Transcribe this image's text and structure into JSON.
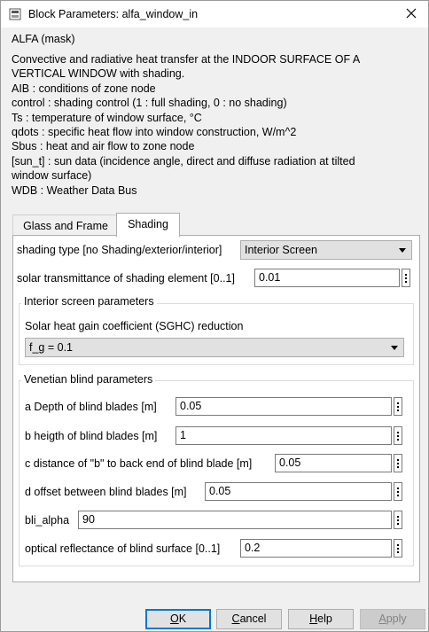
{
  "window": {
    "title": "Block Parameters: alfa_window_in",
    "mask_title": "ALFA (mask)"
  },
  "description": [
    "Convective and radiative heat transfer at the INDOOR SURFACE OF A",
    "VERTICAL WINDOW with shading.",
    "AIB  : conditions of zone node",
    "control : shading control (1 : full shading, 0 : no shading)",
    "Ts  : temperature of window surface, °C",
    "qdots  : specific heat flow into window construction, W/m^2",
    "Sbus : heat and air flow to zone node",
    "[sun_t]  : sun data (incidence angle, direct and diffuse radiation at tilted",
    "window surface)",
    "WDB : Weather Data Bus"
  ],
  "tabs": {
    "glass_frame": "Glass and Frame",
    "shading": "Shading"
  },
  "shading": {
    "type_label": "shading type [no Shading/exterior/interior]",
    "type_value": "Interior Screen",
    "transmittance_label": "solar transmittance of shading element [0..1]",
    "transmittance_value": "0.01"
  },
  "interior_screen": {
    "title": "Interior screen parameters",
    "sghc_label": "Solar heat gain coefficient (SGHC) reduction",
    "sghc_value": "f_g = 0.1"
  },
  "venetian": {
    "title": "Venetian blind parameters",
    "depth_label": "a  Depth of blind blades [m]",
    "depth_value": "0.05",
    "height_label": "b heigth of blind blades [m]",
    "height_value": "1",
    "distance_label": "c distance of \"b\" to back end of blind blade [m]",
    "distance_value": "0.05",
    "offset_label": "d offset between blind blades [m]",
    "offset_value": "0.05",
    "alpha_label": "bli_alpha",
    "alpha_value": "90",
    "reflectance_label": "optical reflectance of blind surface [0..1]",
    "reflectance_value": "0.2"
  },
  "buttons": {
    "ok_u": "O",
    "ok_rest": "K",
    "cancel_u": "C",
    "cancel_rest": "ancel",
    "help_u": "H",
    "help_rest": "elp",
    "apply_u": "A",
    "apply_rest": "pply"
  },
  "colors": {
    "accent": "#0078d7",
    "panel": "#ffffff",
    "dialog": "#f0f0f0"
  }
}
